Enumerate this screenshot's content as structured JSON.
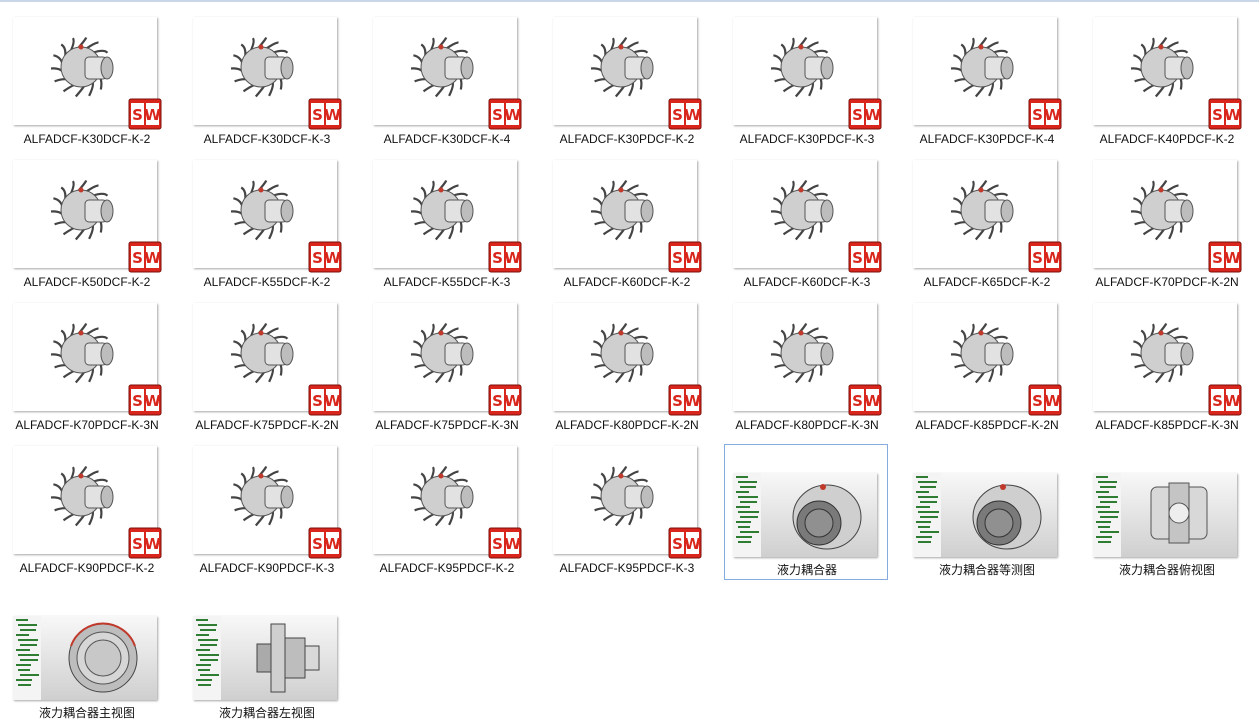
{
  "files": [
    {
      "name": "ALFADCF-K30DCF-K-2",
      "type": "sw"
    },
    {
      "name": "ALFADCF-K30DCF-K-3",
      "type": "sw"
    },
    {
      "name": "ALFADCF-K30DCF-K-4",
      "type": "sw"
    },
    {
      "name": "ALFADCF-K30PDCF-K-2",
      "type": "sw"
    },
    {
      "name": "ALFADCF-K30PDCF-K-3",
      "type": "sw"
    },
    {
      "name": "ALFADCF-K30PDCF-K-4",
      "type": "sw"
    },
    {
      "name": "ALFADCF-K40PDCF-K-2",
      "type": "sw"
    },
    {
      "name": "ALFADCF-K50DCF-K-2",
      "type": "sw"
    },
    {
      "name": "ALFADCF-K55DCF-K-2",
      "type": "sw"
    },
    {
      "name": "ALFADCF-K55DCF-K-3",
      "type": "sw"
    },
    {
      "name": "ALFADCF-K60DCF-K-2",
      "type": "sw"
    },
    {
      "name": "ALFADCF-K60DCF-K-3",
      "type": "sw"
    },
    {
      "name": "ALFADCF-K65DCF-K-2",
      "type": "sw"
    },
    {
      "name": "ALFADCF-K70PDCF-K-2N",
      "type": "sw"
    },
    {
      "name": "ALFADCF-K70PDCF-K-3N",
      "type": "sw"
    },
    {
      "name": "ALFADCF-K75PDCF-K-2N",
      "type": "sw"
    },
    {
      "name": "ALFADCF-K75PDCF-K-3N",
      "type": "sw"
    },
    {
      "name": "ALFADCF-K80PDCF-K-2N",
      "type": "sw"
    },
    {
      "name": "ALFADCF-K80PDCF-K-3N",
      "type": "sw"
    },
    {
      "name": "ALFADCF-K85PDCF-K-2N",
      "type": "sw"
    },
    {
      "name": "ALFADCF-K85PDCF-K-3N",
      "type": "sw"
    },
    {
      "name": "ALFADCF-K90PDCF-K-2",
      "type": "sw"
    },
    {
      "name": "ALFADCF-K90PDCF-K-3",
      "type": "sw"
    },
    {
      "name": "ALFADCF-K95PDCF-K-2",
      "type": "sw"
    },
    {
      "name": "ALFADCF-K95PDCF-K-3",
      "type": "sw"
    },
    {
      "name": "液力耦合器",
      "type": "image",
      "selected": true,
      "view": "iso-dark"
    },
    {
      "name": "液力耦合器等测图",
      "type": "image",
      "view": "iso"
    },
    {
      "name": "液力耦合器俯视图",
      "type": "image",
      "view": "top"
    },
    {
      "name": "液力耦合器主视图",
      "type": "image",
      "view": "front"
    },
    {
      "name": "液力耦合器左视图",
      "type": "image",
      "view": "left"
    }
  ],
  "badge": {
    "text": "SW",
    "color": "#d9261c"
  },
  "colors": {
    "selection_border": "#84acdd",
    "cad_tree": "#2e7d32"
  }
}
